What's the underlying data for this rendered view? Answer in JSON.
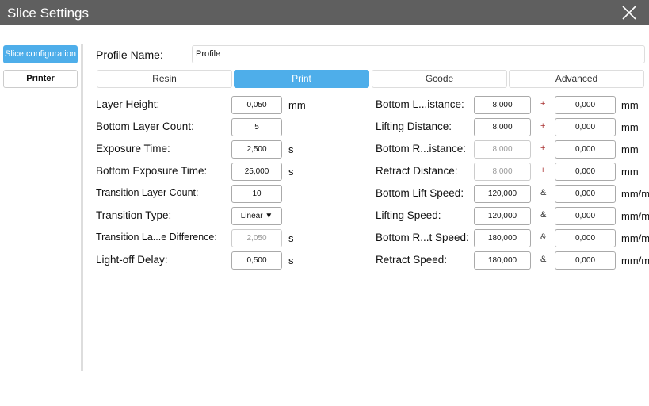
{
  "window": {
    "title": "Slice Settings"
  },
  "sidebar": {
    "items": [
      {
        "label": "Slice configuration",
        "active": true
      },
      {
        "label": "Printer",
        "active": false
      }
    ]
  },
  "profile": {
    "label": "Profile Name:",
    "value": "Profile"
  },
  "tabs": [
    {
      "label": "Resin"
    },
    {
      "label": "Print",
      "active": true
    },
    {
      "label": "Gcode"
    },
    {
      "label": "Advanced"
    }
  ],
  "left_fields": [
    {
      "label": "Layer Height:",
      "value": "0,050",
      "unit": "mm"
    },
    {
      "label": "Bottom Layer Count:",
      "value": "5",
      "unit": ""
    },
    {
      "label": "Exposure Time:",
      "value": "2,500",
      "unit": "s"
    },
    {
      "label": "Bottom Exposure Time:",
      "value": "25,000",
      "unit": "s"
    },
    {
      "label": "Transition Layer Count:",
      "value": "10",
      "unit": ""
    },
    {
      "label": "Transition Type:",
      "value": "Linear",
      "unit": "",
      "dropdown": true
    },
    {
      "label": "Transition La...e Difference:",
      "value": "2,050",
      "unit": "s",
      "disabled": true
    },
    {
      "label": "Light-off Delay:",
      "value": "0,500",
      "unit": "s"
    }
  ],
  "right_fields": [
    {
      "label": "Bottom L...istance:",
      "value": "8,000",
      "sep": "+",
      "value2": "0,000",
      "unit": "mm"
    },
    {
      "label": "Lifting Distance:",
      "value": "8,000",
      "sep": "+",
      "value2": "0,000",
      "unit": "mm"
    },
    {
      "label": "Bottom R...istance:",
      "value": "8,000",
      "sep": "+",
      "value2": "0,000",
      "unit": "mm",
      "disabled": true
    },
    {
      "label": "Retract Distance:",
      "value": "8,000",
      "sep": "+",
      "value2": "0,000",
      "unit": "mm",
      "disabled": true
    },
    {
      "label": "Bottom Lift Speed:",
      "value": "120,000",
      "sep": "&",
      "value2": "0,000",
      "unit": "mm/min"
    },
    {
      "label": "Lifting Speed:",
      "value": "120,000",
      "sep": "&",
      "value2": "0,000",
      "unit": "mm/min"
    },
    {
      "label": "Bottom R...t Speed:",
      "value": "180,000",
      "sep": "&",
      "value2": "0,000",
      "unit": "mm/min"
    },
    {
      "label": "Retract Speed:",
      "value": "180,000",
      "sep": "&",
      "value2": "0,000",
      "unit": "mm/min"
    }
  ]
}
